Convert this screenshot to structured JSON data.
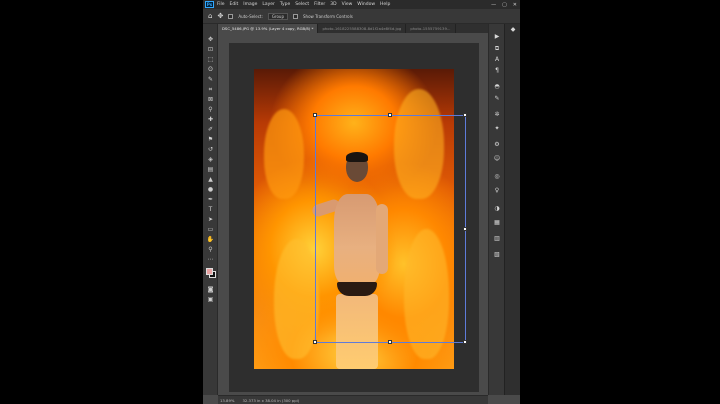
{
  "app": {
    "logo_text": "Ps"
  },
  "menu": [
    "File",
    "Edit",
    "Image",
    "Layer",
    "Type",
    "Select",
    "Filter",
    "3D",
    "View",
    "Window",
    "Help"
  ],
  "window_controls": [
    "—",
    "▢",
    "✕"
  ],
  "options_bar": {
    "auto_select_label": "Auto-Select:",
    "auto_select_target": "Group",
    "transform_controls_label": "Show Transform Controls"
  },
  "tabs": [
    {
      "label": "DSC_5486.JPG @ 13.9% (Layer 4 copy, RGB/8) *",
      "active": true
    },
    {
      "label": "photo-1618225588308-8d1f2a4e8f4d.jpg",
      "active": false
    },
    {
      "label": "photo-1555759139...",
      "active": false
    }
  ],
  "status_bar": {
    "zoom": "13.89%",
    "doc_size": "32.373 in x 38.04 in (300 ppi)"
  },
  "colors": {
    "foreground": "#e8a3a3",
    "background": "#111111",
    "selection_box": "#5e7bd9"
  },
  "toolbar_icons": [
    "move-icon",
    "artboard-icon",
    "marquee-icon",
    "lasso-icon",
    "quick-select-icon",
    "crop-icon",
    "frame-icon",
    "eyedropper-icon",
    "healing-icon",
    "brush-icon",
    "stamp-icon",
    "history-brush-icon",
    "eraser-icon",
    "gradient-icon",
    "blur-icon",
    "dodge-icon",
    "pen-icon",
    "type-icon",
    "path-select-icon",
    "rectangle-icon",
    "hand-icon",
    "zoom-icon",
    "more-tools-icon"
  ],
  "dock_icons": [
    "play-icon",
    "history-icon",
    "character-icon",
    "paragraph-icon",
    "glyphs-icon",
    "brushes-icon",
    "adjustments-icon",
    "styles-icon",
    "properties-icon",
    "libraries-icon",
    "color-icon",
    "swatches-icon",
    "gradients-icon",
    "patterns-icon",
    "layers-icon",
    "channels-icon",
    "paths-icon"
  ]
}
